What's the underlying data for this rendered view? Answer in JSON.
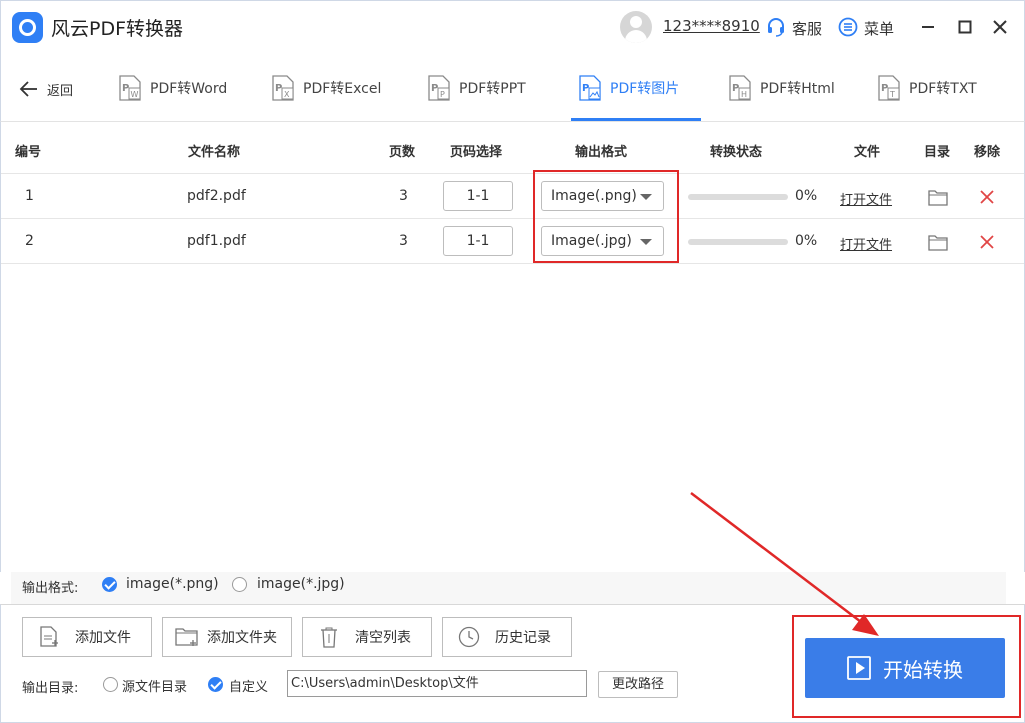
{
  "app": {
    "title": "风云PDF转换器",
    "user": "123****8910",
    "service_label": "客服",
    "menu_label": "菜单"
  },
  "nav": {
    "back_label": "返回",
    "tabs": [
      {
        "label": "PDF转Word",
        "badge": "W"
      },
      {
        "label": "PDF转Excel",
        "badge": "X"
      },
      {
        "label": "PDF转PPT",
        "badge": "P"
      },
      {
        "label": "PDF转图片",
        "badge": "P"
      },
      {
        "label": "PDF转Html",
        "badge": "H"
      },
      {
        "label": "PDF转TXT",
        "badge": "T"
      }
    ],
    "active_tab": 3
  },
  "table": {
    "headers": {
      "index": "编号",
      "name": "文件名称",
      "pages": "页数",
      "page_select": "页码选择",
      "format": "输出格式",
      "status": "转换状态",
      "file": "文件",
      "dir": "目录",
      "remove": "移除"
    },
    "rows": [
      {
        "index": "1",
        "name": "pdf2.pdf",
        "pages": "3",
        "page_range": "1-1",
        "format": "Image(.png)",
        "progress": 0,
        "progress_label": "0%",
        "open_label": "打开文件"
      },
      {
        "index": "2",
        "name": "pdf1.pdf",
        "pages": "3",
        "page_range": "1-1",
        "format": "Image(.jpg)",
        "progress": 0,
        "progress_label": "0%",
        "open_label": "打开文件"
      }
    ]
  },
  "output_format": {
    "label": "输出格式:",
    "options": [
      "image(*.png)",
      "image(*.jpg)"
    ],
    "selected": 0
  },
  "toolbar": {
    "add_file": "添加文件",
    "add_folder": "添加文件夹",
    "clear_list": "清空列表",
    "history": "历史记录"
  },
  "output_dir": {
    "label": "输出目录:",
    "source_label": "源文件目录",
    "custom_label": "自定义",
    "selected": "custom",
    "path": "C:\\Users\\admin\\Desktop\\文件",
    "change_label": "更改路径"
  },
  "start": {
    "label": "开始转换"
  },
  "colors": {
    "accent": "#2f7ff5",
    "annotation": "#e02828",
    "start_button": "#3a7de8"
  }
}
